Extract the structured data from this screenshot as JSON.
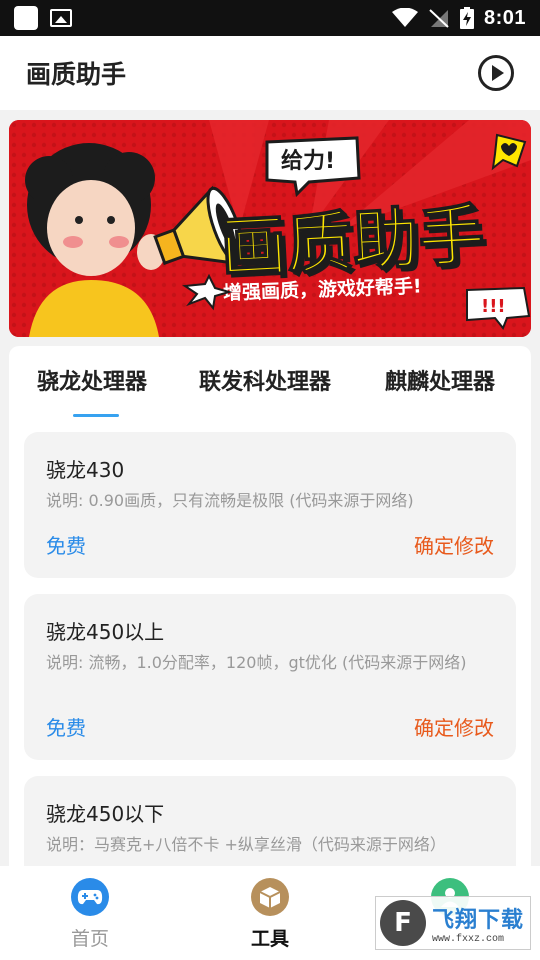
{
  "status_bar": {
    "time": "8:01",
    "icons": [
      "app-square-icon",
      "image-icon",
      "wifi-icon",
      "no-signal-icon",
      "battery-charging-icon"
    ]
  },
  "app_bar": {
    "title": "画质助手",
    "play_icon": "play-circle-icon"
  },
  "banner": {
    "badge_text": "给力!",
    "headline": "画质助手",
    "tagline": "增强画质，游戏好帮手!",
    "exclaim": "!!!",
    "colors": {
      "background": "#d9151c",
      "headline": "#ffe600",
      "shirt": "#f7c51e"
    }
  },
  "tabs": [
    {
      "label": "骁龙处理器",
      "active": true
    },
    {
      "label": "联发科处理器",
      "active": false
    },
    {
      "label": "麒麟处理器",
      "active": false
    }
  ],
  "items": [
    {
      "title": "骁龙430",
      "description": "说明: 0.90画质，只有流畅是极限 (代码来源于网络)",
      "price": "免费",
      "action": "确定修改"
    },
    {
      "title": "骁龙450以上",
      "description": "说明: 流畅，1.0分配率，120帧，gt优化 (代码来源于网络)",
      "price": "免费",
      "action": "确定修改"
    },
    {
      "title": "骁龙450以下",
      "description": "说明：马赛克+八倍不卡 +纵享丝滑（代码来源于网络）",
      "price": "",
      "action": ""
    }
  ],
  "bottom_nav": [
    {
      "label": "首页",
      "icon": "gamepad-icon",
      "active": false
    },
    {
      "label": "工具",
      "icon": "box-icon",
      "active": true
    },
    {
      "label": "",
      "icon": "user-icon",
      "active": false
    }
  ],
  "watermark": {
    "name": "飞翔下载",
    "url": "www.fxxz.com"
  },
  "colors": {
    "accent_blue": "#2a8be8",
    "accent_orange": "#e85a1c",
    "tab_indicator": "#37a2f0"
  }
}
